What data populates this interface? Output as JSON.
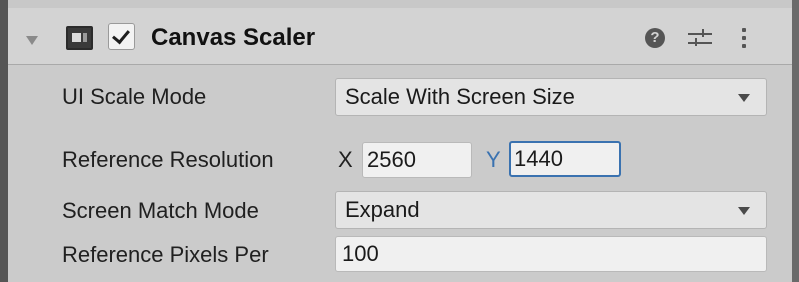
{
  "component": {
    "title": "Canvas Scaler",
    "enabled": true,
    "expanded": true,
    "icons": {
      "foldout": "foldout-arrow-icon",
      "component": "canvas-scaler-icon",
      "help": "help-icon",
      "presets": "presets-sliders-icon",
      "menu": "kebab-menu-icon"
    },
    "help_glyph": "?"
  },
  "fields": {
    "ui_scale_mode": {
      "label": "UI Scale Mode",
      "value": "Scale With Screen Size"
    },
    "reference_resolution": {
      "label": "Reference Resolution",
      "x_label": "X",
      "x_value": "2560",
      "y_label": "Y",
      "y_value": "1440"
    },
    "screen_match_mode": {
      "label": "Screen Match Mode",
      "value": "Expand"
    },
    "reference_pixels_per_unit": {
      "label": "Reference Pixels Per",
      "value": "100"
    }
  },
  "colors": {
    "focus_border": "#3a72b0",
    "y_axis_label": "#3a72b0",
    "x_axis_label": "#202020"
  }
}
